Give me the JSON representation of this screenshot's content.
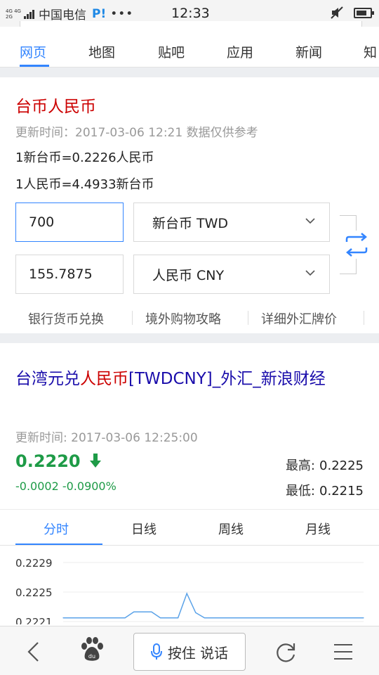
{
  "status_bar": {
    "network_top": "4G 4G",
    "network_bottom": "2G",
    "carrier": "中国电信",
    "flag": "P!",
    "dots": "•••",
    "time": "12:33"
  },
  "tabs": [
    {
      "label": "网页",
      "active": true
    },
    {
      "label": "地图"
    },
    {
      "label": "贴吧"
    },
    {
      "label": "应用"
    },
    {
      "label": "新闻"
    },
    {
      "label": "知"
    }
  ],
  "converter": {
    "title": "台币人民币",
    "update_time": "更新时间：2017-03-06 12:21 数据仅供参考",
    "rate1": "1新台币=0.2226人民币",
    "rate2": "1人民币=4.4933新台币",
    "amount_from": "700",
    "currency_from": "新台币 TWD",
    "amount_to": "155.7875",
    "currency_to": "人民币 CNY",
    "links": [
      "银行货币兑换",
      "境外购物攻略",
      "详细外汇牌价"
    ]
  },
  "result": {
    "headline_part1": "台湾元兑",
    "headline_part2": "人民币",
    "headline_part3": "[TWDCNY]_外汇_新浪财经",
    "update_time": "更新时间: 2017-03-06 12:25:00",
    "price": "0.2220",
    "trend": "down",
    "change": "-0.0002  -0.0900%",
    "high_label": "最高:",
    "high_value": "0.2225",
    "low_label": "最低:",
    "low_value": "0.2215",
    "chart_tabs": [
      "分时",
      "日线",
      "周线",
      "月线"
    ],
    "y_ticks": [
      "0.2229",
      "0.2225",
      "0.2221"
    ]
  },
  "chart_data": {
    "type": "line",
    "title": "",
    "xlabel": "",
    "ylabel": "",
    "ylim": [
      0.2221,
      0.2229
    ],
    "y_ticks": [
      0.2229,
      0.2225,
      0.2221
    ],
    "series": [
      {
        "values": [
          0.22215,
          0.22215,
          0.22215,
          0.22215,
          0.22215,
          0.22215,
          0.22215,
          0.22215,
          0.22223,
          0.22223,
          0.22223,
          0.22215,
          0.22215,
          0.22215,
          0.22248,
          0.22222,
          0.22215,
          0.22215,
          0.22215,
          0.22215,
          0.22215,
          0.22215,
          0.22215,
          0.22215,
          0.22215,
          0.22215,
          0.22215,
          0.22215,
          0.22215,
          0.22215,
          0.22215,
          0.22215,
          0.22215,
          0.22215,
          0.22215
        ]
      }
    ]
  },
  "bottom_bar": {
    "voice_label": "按住 说话"
  },
  "colors": {
    "accent": "#3385ff",
    "title_red": "#cc0000",
    "link_blue": "#1a0dab",
    "down_green": "#1e9b47"
  }
}
